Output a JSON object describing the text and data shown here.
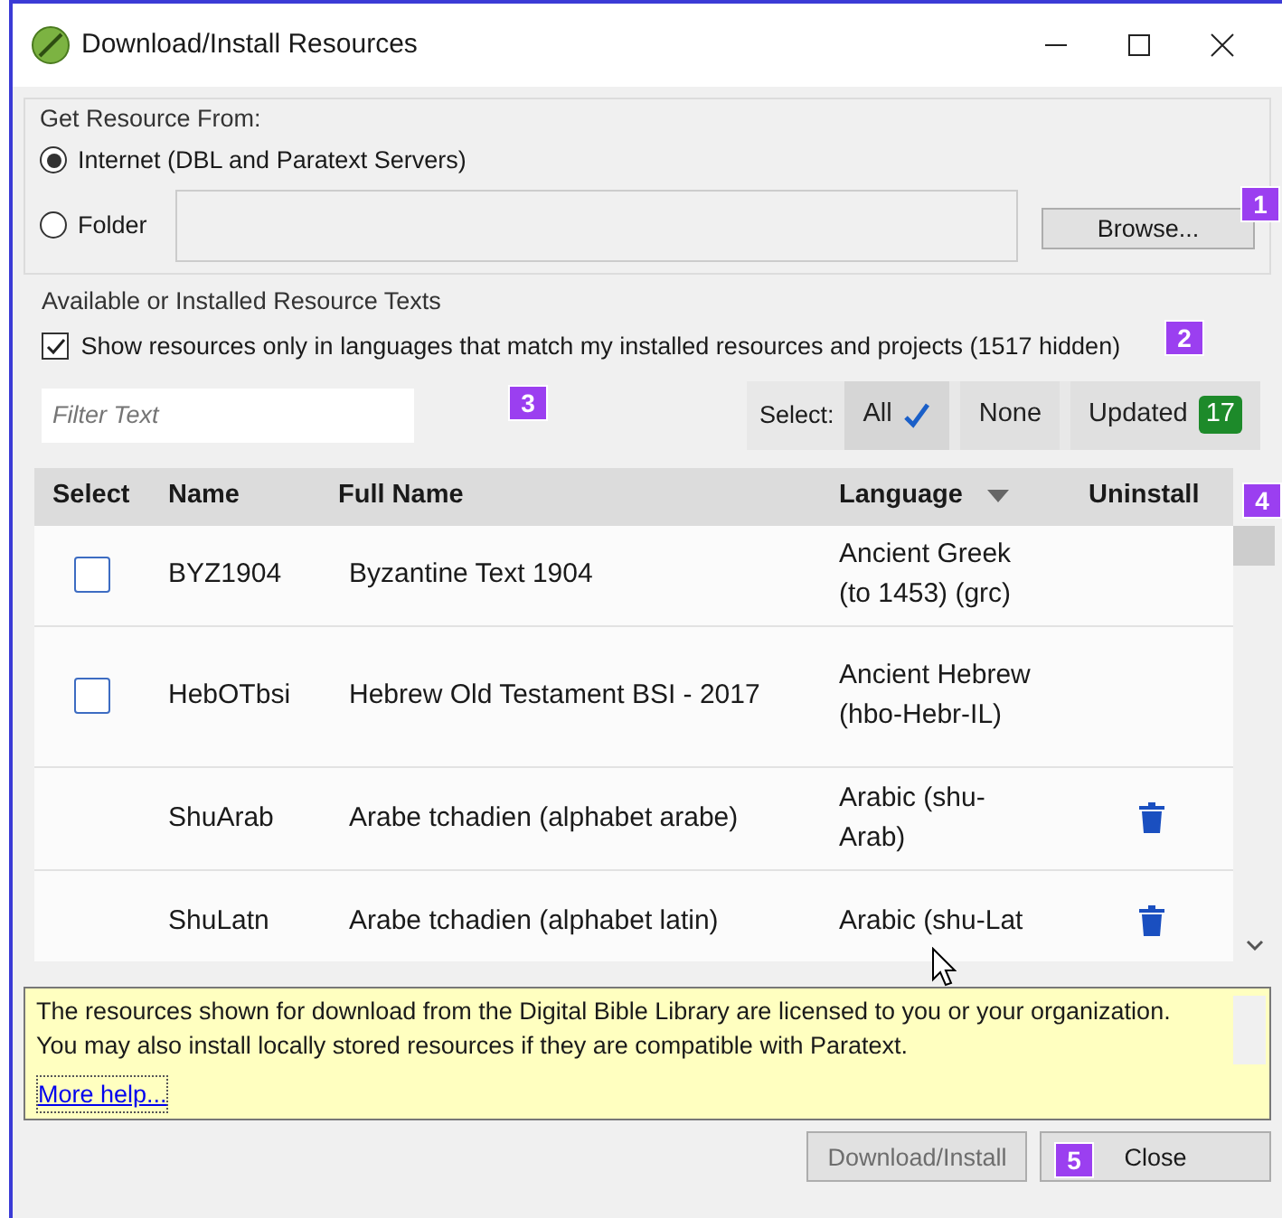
{
  "window": {
    "title": "Download/Install Resources"
  },
  "source_group": {
    "title": "Get Resource From:",
    "options": [
      {
        "label": "Internet (DBL and Paratext Servers)",
        "selected": true
      },
      {
        "label": "Folder",
        "selected": false
      }
    ],
    "browse_button": "Browse..."
  },
  "resources_group": {
    "title": "Available or Installed Resource Texts",
    "filter_checkbox": {
      "label": "Show resources only in languages that match my installed resources and projects (1517 hidden)",
      "checked": true
    },
    "filter": {
      "placeholder": "Filter Text"
    },
    "select_label": "Select:",
    "select_buttons": [
      {
        "label": "All",
        "selected": true
      },
      {
        "label": "None",
        "selected": false
      },
      {
        "label": "Updated",
        "badge": "17",
        "selected": false
      }
    ]
  },
  "table": {
    "columns": [
      "Select",
      "Name",
      "Full Name",
      "Language",
      "Uninstall"
    ],
    "rows": [
      {
        "kind": "available",
        "checked": false,
        "name": "BYZ1904",
        "full_name": "Byzantine Text 1904",
        "language": "Ancient Greek (to 1453) (grc)"
      },
      {
        "kind": "available",
        "checked": false,
        "name": "HebOTbsi",
        "full_name": "Hebrew Old Testament BSI - 2017",
        "language": "Ancient Hebrew (hbo-Hebr-IL)"
      },
      {
        "kind": "installed",
        "name": "ShuArab",
        "full_name": "Arabe tchadien (alphabet arabe)",
        "language": "Arabic (shu-Arab)"
      },
      {
        "kind": "installed",
        "name": "ShuLatn",
        "full_name": "Arabe tchadien (alphabet latin)",
        "language": "Arabic (shu-Lat"
      }
    ]
  },
  "info": {
    "text": "The resources shown for download from the Digital Bible Library are licensed to you or your organization. You may also install locally stored resources if they are compatible with Paratext.",
    "link": "More help..."
  },
  "buttons": [
    {
      "label": "Download/Install",
      "disabled": true
    },
    {
      "label": "Close",
      "disabled": false
    }
  ],
  "callouts": [
    "1",
    "2",
    "3",
    "4",
    "5"
  ]
}
